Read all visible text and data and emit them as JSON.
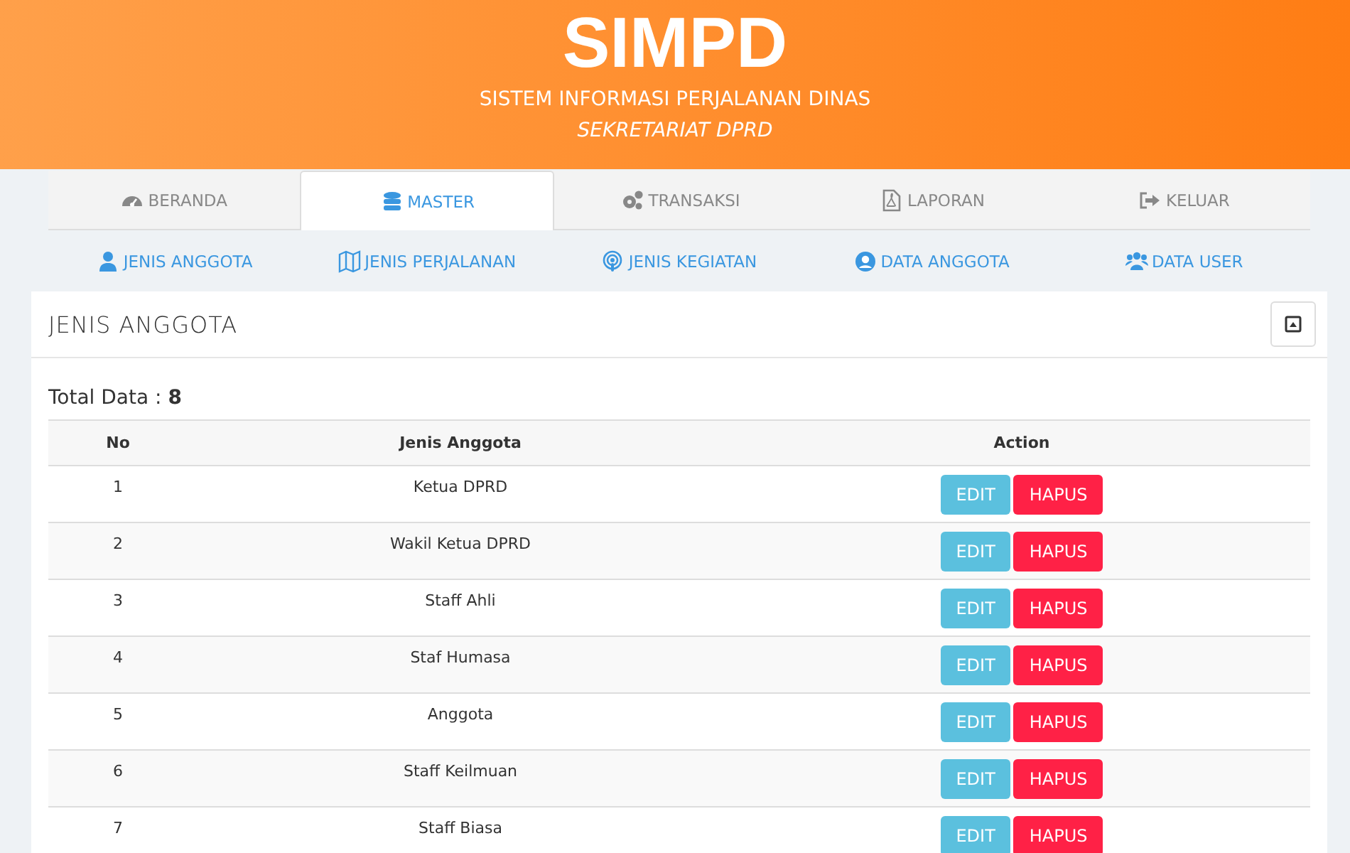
{
  "header": {
    "title": "SIMPD",
    "subtitle": "SISTEM INFORMASI PERJALANAN DINAS",
    "org": "SEKRETARIAT DPRD"
  },
  "tabs": [
    {
      "label": "BERANDA",
      "selected": false
    },
    {
      "label": "MASTER",
      "selected": true
    },
    {
      "label": "TRANSAKSI",
      "selected": false
    },
    {
      "label": "LAPORAN",
      "selected": false
    },
    {
      "label": "KELUAR",
      "selected": false
    }
  ],
  "subnav": [
    {
      "label": "JENIS ANGGOTA"
    },
    {
      "label": "JENIS PERJALANAN"
    },
    {
      "label": "JENIS KEGIATAN"
    },
    {
      "label": "DATA ANGGOTA"
    },
    {
      "label": "DATA USER"
    }
  ],
  "card": {
    "title": "JENIS ANGGOTA",
    "total_label": "Total Data : ",
    "total_value": "8"
  },
  "table": {
    "columns": [
      "No",
      "Jenis Anggota",
      "Action"
    ],
    "rows": [
      {
        "no": "1",
        "name": "Ketua DPRD",
        "edit": "EDIT",
        "delete": "HAPUS"
      },
      {
        "no": "2",
        "name": "Wakil Ketua DPRD",
        "edit": "EDIT",
        "delete": "HAPUS"
      },
      {
        "no": "3",
        "name": "Staff Ahli",
        "edit": "EDIT",
        "delete": "HAPUS"
      },
      {
        "no": "4",
        "name": "Staf Humasa",
        "edit": "EDIT",
        "delete": "HAPUS"
      },
      {
        "no": "5",
        "name": "Anggota",
        "edit": "EDIT",
        "delete": "HAPUS"
      },
      {
        "no": "6",
        "name": "Staff Keilmuan",
        "edit": "EDIT",
        "delete": "HAPUS"
      },
      {
        "no": "7",
        "name": "Staff Biasa",
        "edit": "EDIT",
        "delete": "HAPUS"
      }
    ]
  }
}
